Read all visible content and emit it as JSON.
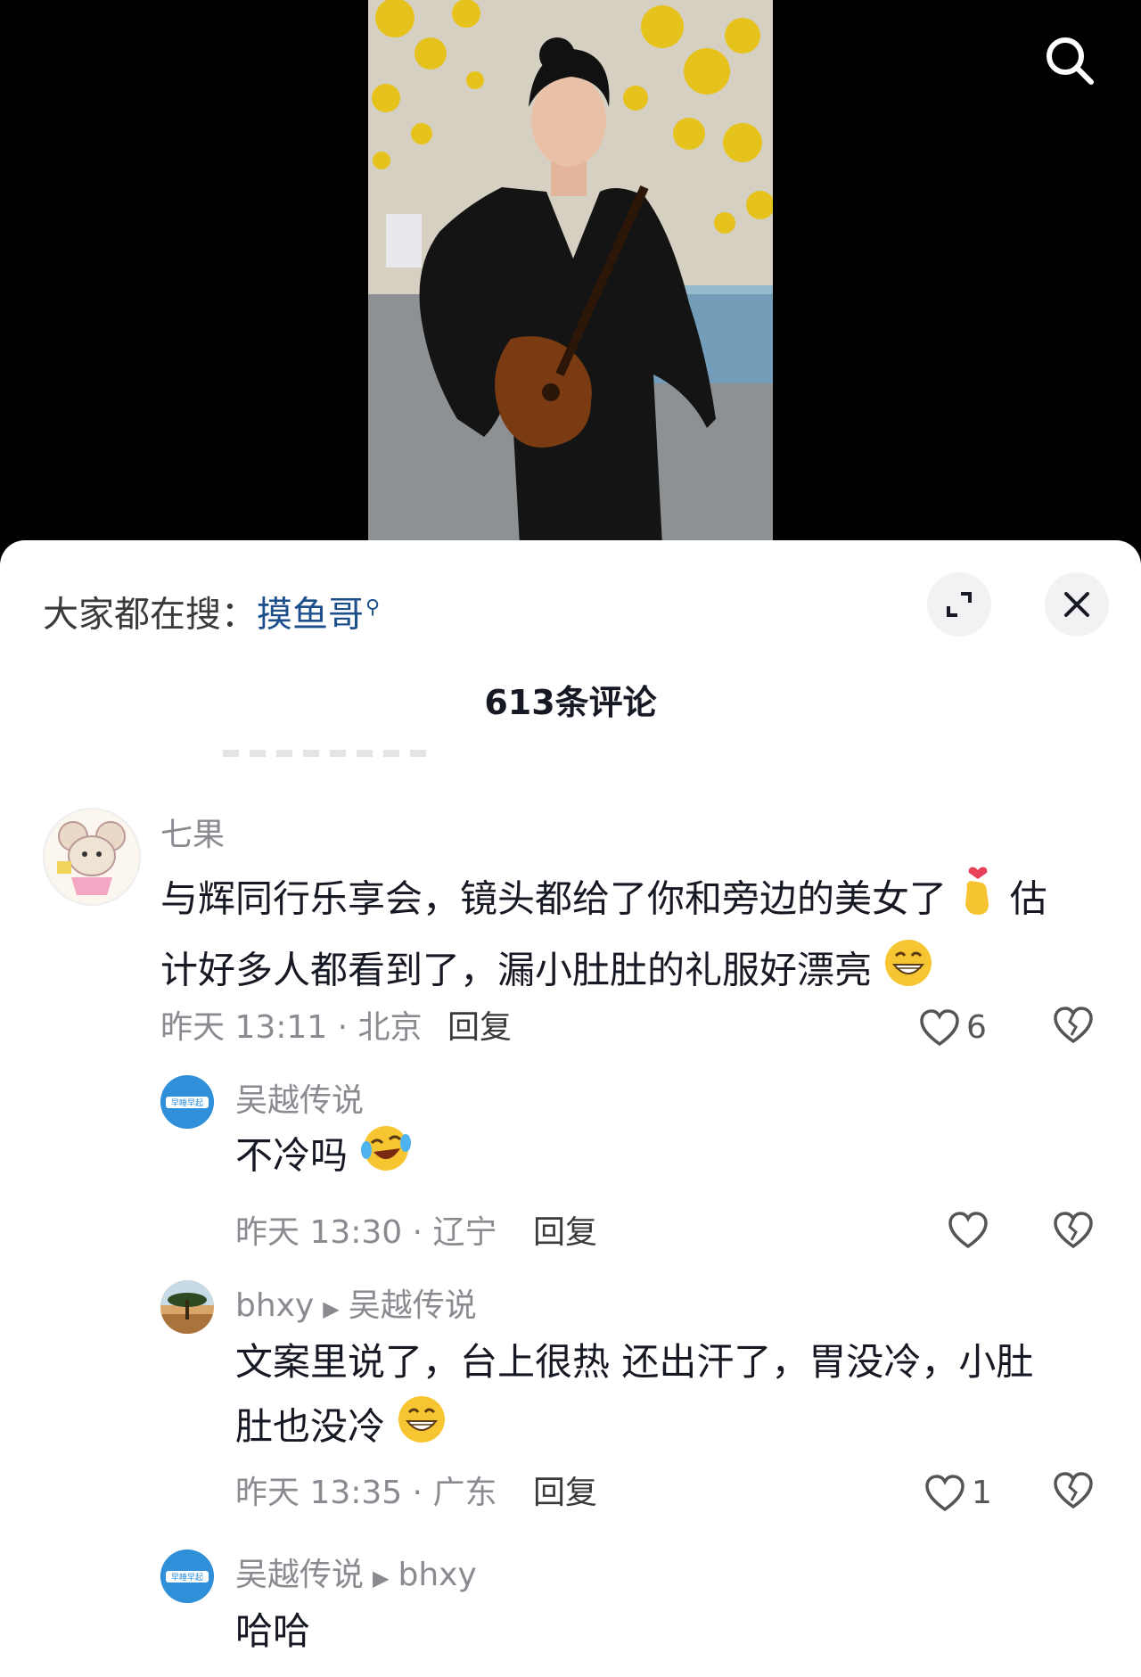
{
  "hot_search": {
    "prefix": "大家都在搜：",
    "keyword": "摸鱼哥"
  },
  "comment_count_label": "613条评论",
  "colors": {
    "accent_link": "#1c4f8c",
    "meta_gray": "#8a8b91",
    "sheet_bg": "#ffffff"
  },
  "comments": [
    {
      "author": "七果",
      "text_1": "与辉同行乐享会，镜头都给了你和旁边的美女了",
      "text_2": "估",
      "text_3": "计好多人都看到了，漏小肚肚的礼服好漂亮",
      "time": "昨天 13:11 · 北京",
      "reply_label": "回复",
      "likes": "6"
    },
    {
      "author": "吴越传说",
      "avatar_text": "早睡早起",
      "text": "不冷吗",
      "time": "昨天 13:30 · 辽宁",
      "reply_label": "回复",
      "likes": ""
    },
    {
      "author": "bhxy",
      "reply_to": "吴越传说",
      "text_1": "文案里说了，台上很热 还出汗了，胃没冷，小肚",
      "text_2": "肚也没冷",
      "time": "昨天 13:35 · 广东",
      "reply_label": "回复",
      "likes": "1"
    },
    {
      "author": "吴越传说",
      "avatar_text": "早睡早起",
      "reply_to": "bhxy",
      "text": "哈哈"
    }
  ],
  "icons": {
    "search": "search-icon",
    "expand": "expand-icon",
    "close": "close-icon",
    "like": "heart-icon",
    "dislike": "broken-heart-icon"
  }
}
